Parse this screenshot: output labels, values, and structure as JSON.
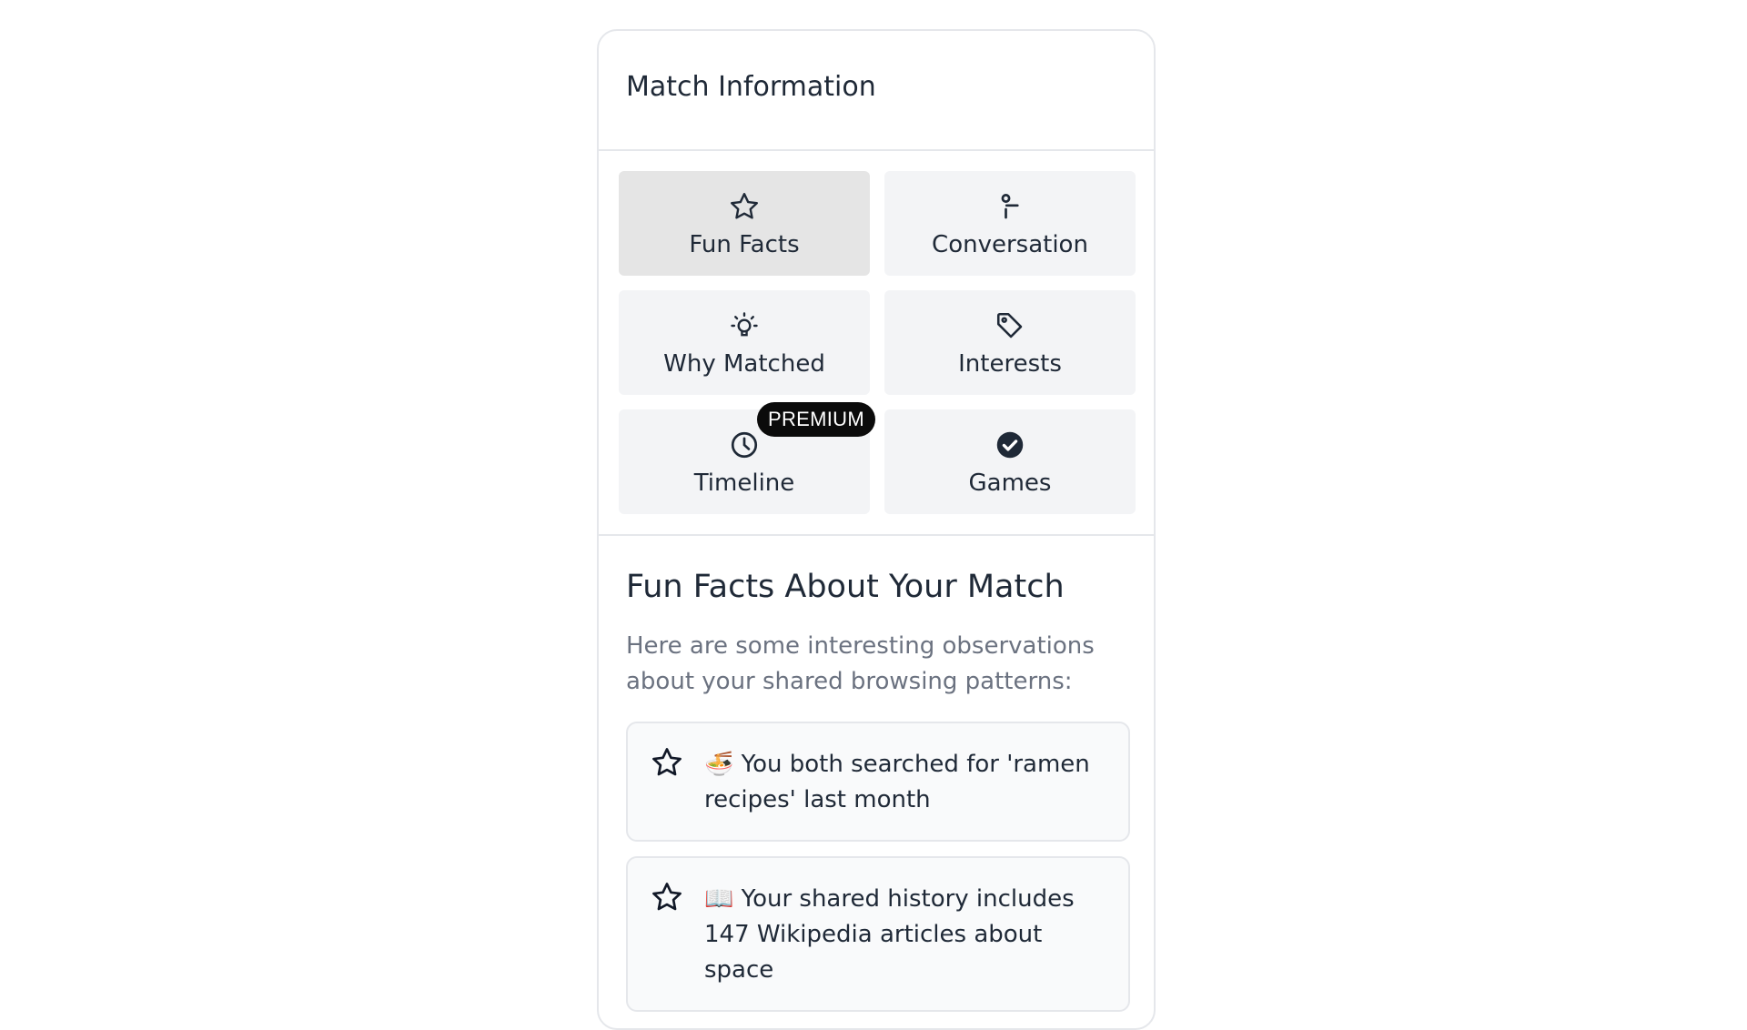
{
  "panel": {
    "title": "Match Information"
  },
  "tabs": [
    {
      "label": "Fun Facts",
      "icon": "star-icon",
      "active": true
    },
    {
      "label": "Conversation",
      "icon": "person-speaking-icon",
      "active": false
    },
    {
      "label": "Why Matched",
      "icon": "lightbulb-icon",
      "active": false
    },
    {
      "label": "Interests",
      "icon": "tag-icon",
      "active": false
    },
    {
      "label": "Timeline",
      "icon": "clock-icon",
      "active": false,
      "badge": "PREMIUM"
    },
    {
      "label": "Games",
      "icon": "check-circle-icon",
      "active": false
    }
  ],
  "content": {
    "title": "Fun Facts About Your Match",
    "intro": "Here are some interesting observations about your shared browsing patterns:",
    "facts": [
      {
        "icon": "star-icon",
        "text": "🍜 You both searched for 'ramen recipes' last month"
      },
      {
        "icon": "star-icon",
        "text": "📖 Your shared history includes 147 Wikipedia articles about space"
      }
    ]
  },
  "colors": {
    "active_tab": "#e5e5e5",
    "tab_bg": "#f3f4f6",
    "badge_bg": "#0b0b0b",
    "border": "#e5e7eb"
  }
}
